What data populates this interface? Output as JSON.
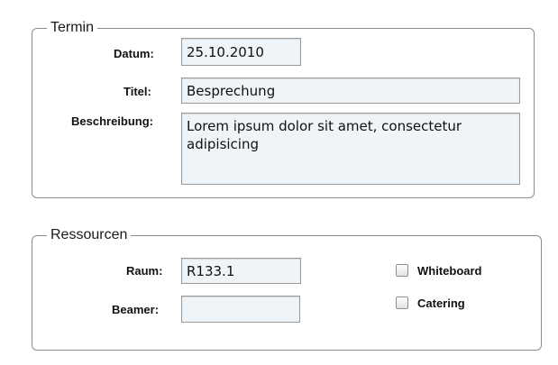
{
  "termin": {
    "legend": "Termin",
    "datum": {
      "label": "Datum:",
      "value": "25.10.2010"
    },
    "titel": {
      "label": "Titel:",
      "value": "Besprechung"
    },
    "beschreibung": {
      "label": "Beschreibung:",
      "value": "Lorem ipsum dolor sit amet, consectetur adipisicing"
    }
  },
  "ressourcen": {
    "legend": "Ressourcen",
    "raum": {
      "label": "Raum:",
      "value": "R133.1"
    },
    "beamer": {
      "label": "Beamer:",
      "value": ""
    },
    "whiteboard": {
      "label": "Whiteboard",
      "checked": false
    },
    "catering": {
      "label": "Catering",
      "checked": false
    }
  }
}
